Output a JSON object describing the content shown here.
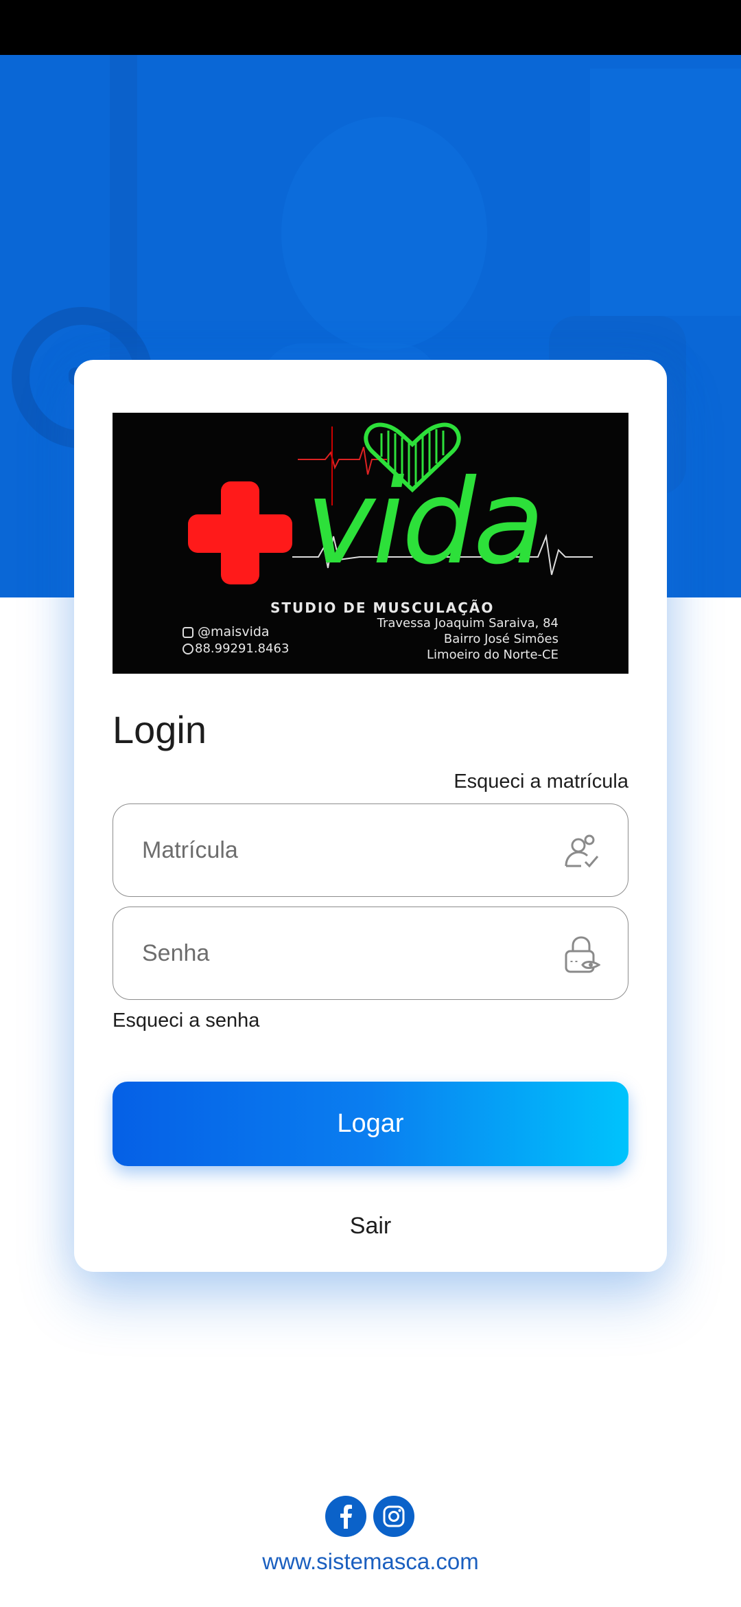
{
  "colors": {
    "hero_blue": "#0a67d6",
    "button_gradient_start": "#0560e6",
    "button_gradient_end": "#00c3fc",
    "social_blue": "#0b62c9",
    "link_blue": "#1a5fbf",
    "logo_green": "#2de03a",
    "logo_red": "#ff1a1a"
  },
  "logo": {
    "wordmark": "vida",
    "subtitle": "STUDIO DE MUSCULAÇÃO",
    "instagram": "@maisvida",
    "phone": "88.99291.8463",
    "address_line1": "Travessa Joaquim Saraiva, 84",
    "address_line2": "Bairro José Simões",
    "address_line3": "Limoeiro do Norte-CE"
  },
  "login": {
    "title": "Login",
    "forgot_id_label": "Esqueci a matrícula",
    "id_placeholder": "Matrícula",
    "password_placeholder": "Senha",
    "forgot_password_label": "Esqueci a senha",
    "submit_label": "Logar",
    "exit_label": "Sair"
  },
  "icons": {
    "id_field": "user-check-icon",
    "password_field": "lock-eye-icon",
    "social_1": "facebook-icon",
    "social_2": "instagram-icon"
  },
  "footer": {
    "website": "www.sistemasca.com"
  }
}
